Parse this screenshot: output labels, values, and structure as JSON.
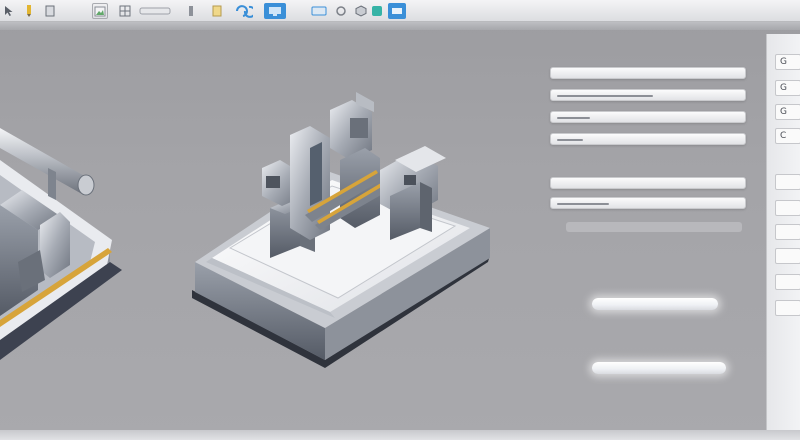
{
  "toolbar": {
    "buttons": [
      {
        "icon": "cursor-icon"
      },
      {
        "icon": "pencil-icon"
      },
      {
        "icon": "layers-icon"
      },
      {
        "icon": "image-icon"
      },
      {
        "icon": "grid-icon"
      },
      {
        "icon": "rotate-icon"
      },
      {
        "icon": "monitor-icon"
      },
      {
        "icon": "window-icon"
      },
      {
        "icon": "orbit-icon"
      },
      {
        "icon": "cube-icon"
      },
      {
        "icon": "render-icon"
      }
    ]
  },
  "properties": {
    "sliders": [
      {
        "value": 0
      },
      {
        "value": 0.52
      },
      {
        "value": 0.18
      },
      {
        "value": 0.14
      },
      {
        "value": 0
      },
      {
        "value": 0.28
      }
    ]
  },
  "side_panel": {
    "items": [
      {
        "label": "G"
      },
      {
        "label": "G"
      },
      {
        "label": "G"
      },
      {
        "label": "C"
      },
      {
        "label": ""
      },
      {
        "label": ""
      },
      {
        "label": ""
      },
      {
        "label": ""
      },
      {
        "label": ""
      },
      {
        "label": ""
      }
    ]
  },
  "colors": {
    "accent": "#3a8fd8",
    "background": "#a4a4a8",
    "metal": "#8c929e",
    "highlight": "#d7a43a"
  }
}
